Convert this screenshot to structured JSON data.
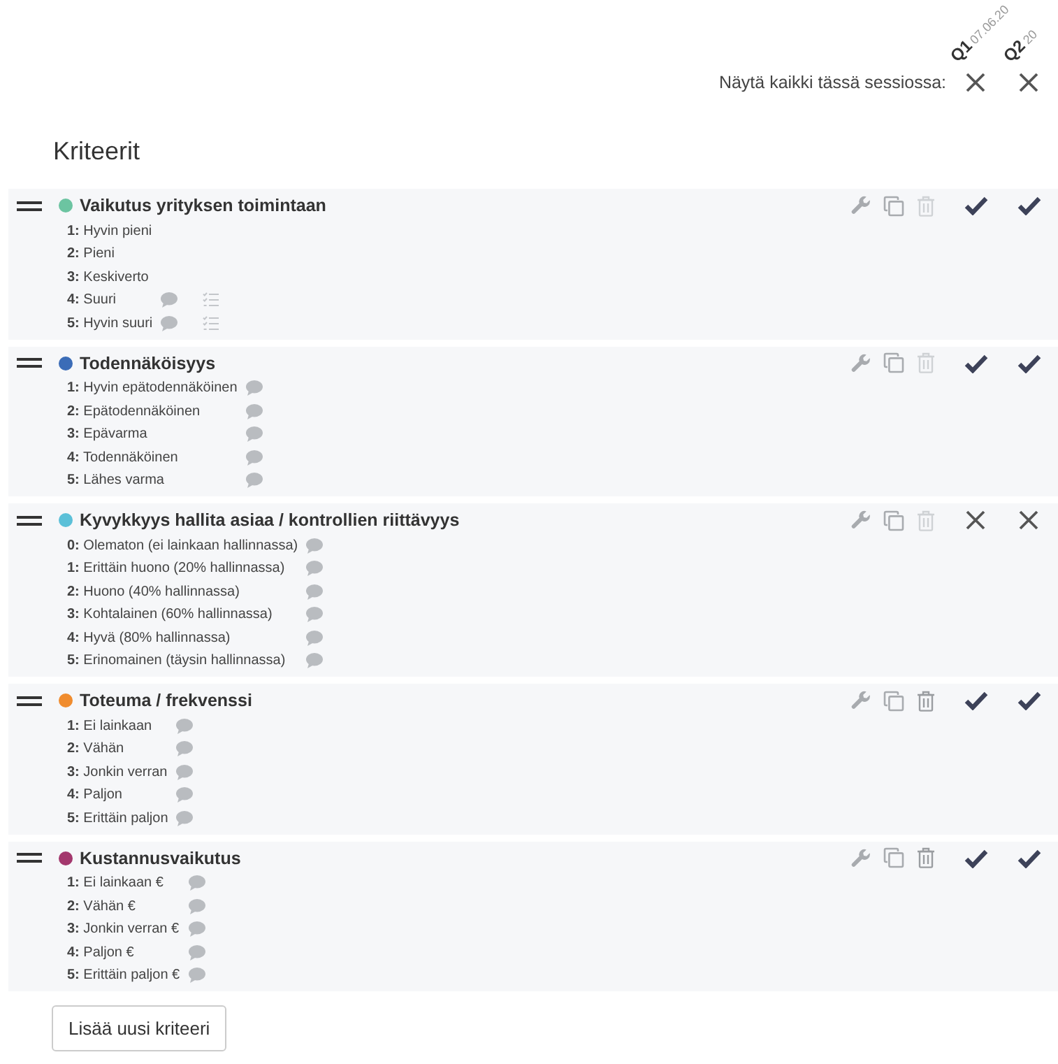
{
  "sessions": [
    {
      "label": "Q1",
      "date": "07.06.20"
    },
    {
      "label": "Q2",
      "date": "20"
    }
  ],
  "show_all": {
    "label": "Näytä kaikki tässä sessiossa:",
    "marks": [
      {
        "kind": "cross"
      },
      {
        "kind": "cross"
      }
    ]
  },
  "title": "Kriteerit",
  "criteria": [
    {
      "name": "Vaikutus yrityksen toimintaan",
      "color": "#6cc4a1",
      "delete_enabled": false,
      "marks": [
        {
          "kind": "check"
        },
        {
          "kind": "check"
        }
      ],
      "levels": [
        {
          "label": "**1:** Hyvin pieni",
          "comment": false,
          "checklist": false
        },
        {
          "label": "**2:** Pieni",
          "comment": false,
          "checklist": false
        },
        {
          "label": "**3:** Keskiverto",
          "comment": false,
          "checklist": false
        },
        {
          "label": "**4:** Suuri",
          "comment": true,
          "checklist": true
        },
        {
          "label": "**5:** Hyvin suuri",
          "comment": true,
          "checklist": true
        }
      ]
    },
    {
      "name": "Todennäköisyys",
      "color": "#3b6cb7",
      "delete_enabled": false,
      "marks": [
        {
          "kind": "check"
        },
        {
          "kind": "check"
        }
      ],
      "levels": [
        {
          "label": "**1:** Hyvin epätodennäköinen",
          "comment": true
        },
        {
          "label": "**2:** Epätodennäköinen",
          "comment": true
        },
        {
          "label": "**3:** Epävarma",
          "comment": true
        },
        {
          "label": "**4:** Todennäköinen",
          "comment": true
        },
        {
          "label": "**5:** Lähes varma",
          "comment": true
        }
      ]
    },
    {
      "name": "Kyvykkyys hallita asiaa / kontrollien riittävyys",
      "color": "#5bc0d8",
      "delete_enabled": false,
      "marks": [
        {
          "kind": "cross"
        },
        {
          "kind": "cross"
        }
      ],
      "levels": [
        {
          "label": "**0:** Olematon (ei lainkaan hallinnassa)",
          "comment": true
        },
        {
          "label": "**1:** Erittäin huono (20% hallinnassa)",
          "comment": true
        },
        {
          "label": "**2:** Huono (40% hallinnassa)",
          "comment": true
        },
        {
          "label": "**3:** Kohtalainen (60% hallinnassa)",
          "comment": true
        },
        {
          "label": "**4:** Hyvä (80% hallinnassa)",
          "comment": true
        },
        {
          "label": "**5:** Erinomainen (täysin hallinnassa)",
          "comment": true
        }
      ]
    },
    {
      "name": "Toteuma / frekvenssi",
      "color": "#f08c2e",
      "delete_enabled": true,
      "marks": [
        {
          "kind": "check"
        },
        {
          "kind": "check"
        }
      ],
      "levels": [
        {
          "label": "**1:** Ei lainkaan",
          "comment": true
        },
        {
          "label": "**2:** Vähän",
          "comment": true
        },
        {
          "label": "**3:** Jonkin verran",
          "comment": true
        },
        {
          "label": "**4:** Paljon",
          "comment": true
        },
        {
          "label": "**5:** Erittäin paljon",
          "comment": true
        }
      ]
    },
    {
      "name": "Kustannusvaikutus",
      "color": "#a3376d",
      "delete_enabled": true,
      "marks": [
        {
          "kind": "check"
        },
        {
          "kind": "check"
        }
      ],
      "levels": [
        {
          "label": "**1:** Ei lainkaan €",
          "comment": true
        },
        {
          "label": "**2:** Vähän €",
          "comment": true
        },
        {
          "label": "**3:** Jonkin verran €",
          "comment": true
        },
        {
          "label": "**4:** Paljon €",
          "comment": true
        },
        {
          "label": "**5:** Erittäin paljon €",
          "comment": true
        }
      ]
    }
  ],
  "add_button": "Lisää uusi kriteeri"
}
